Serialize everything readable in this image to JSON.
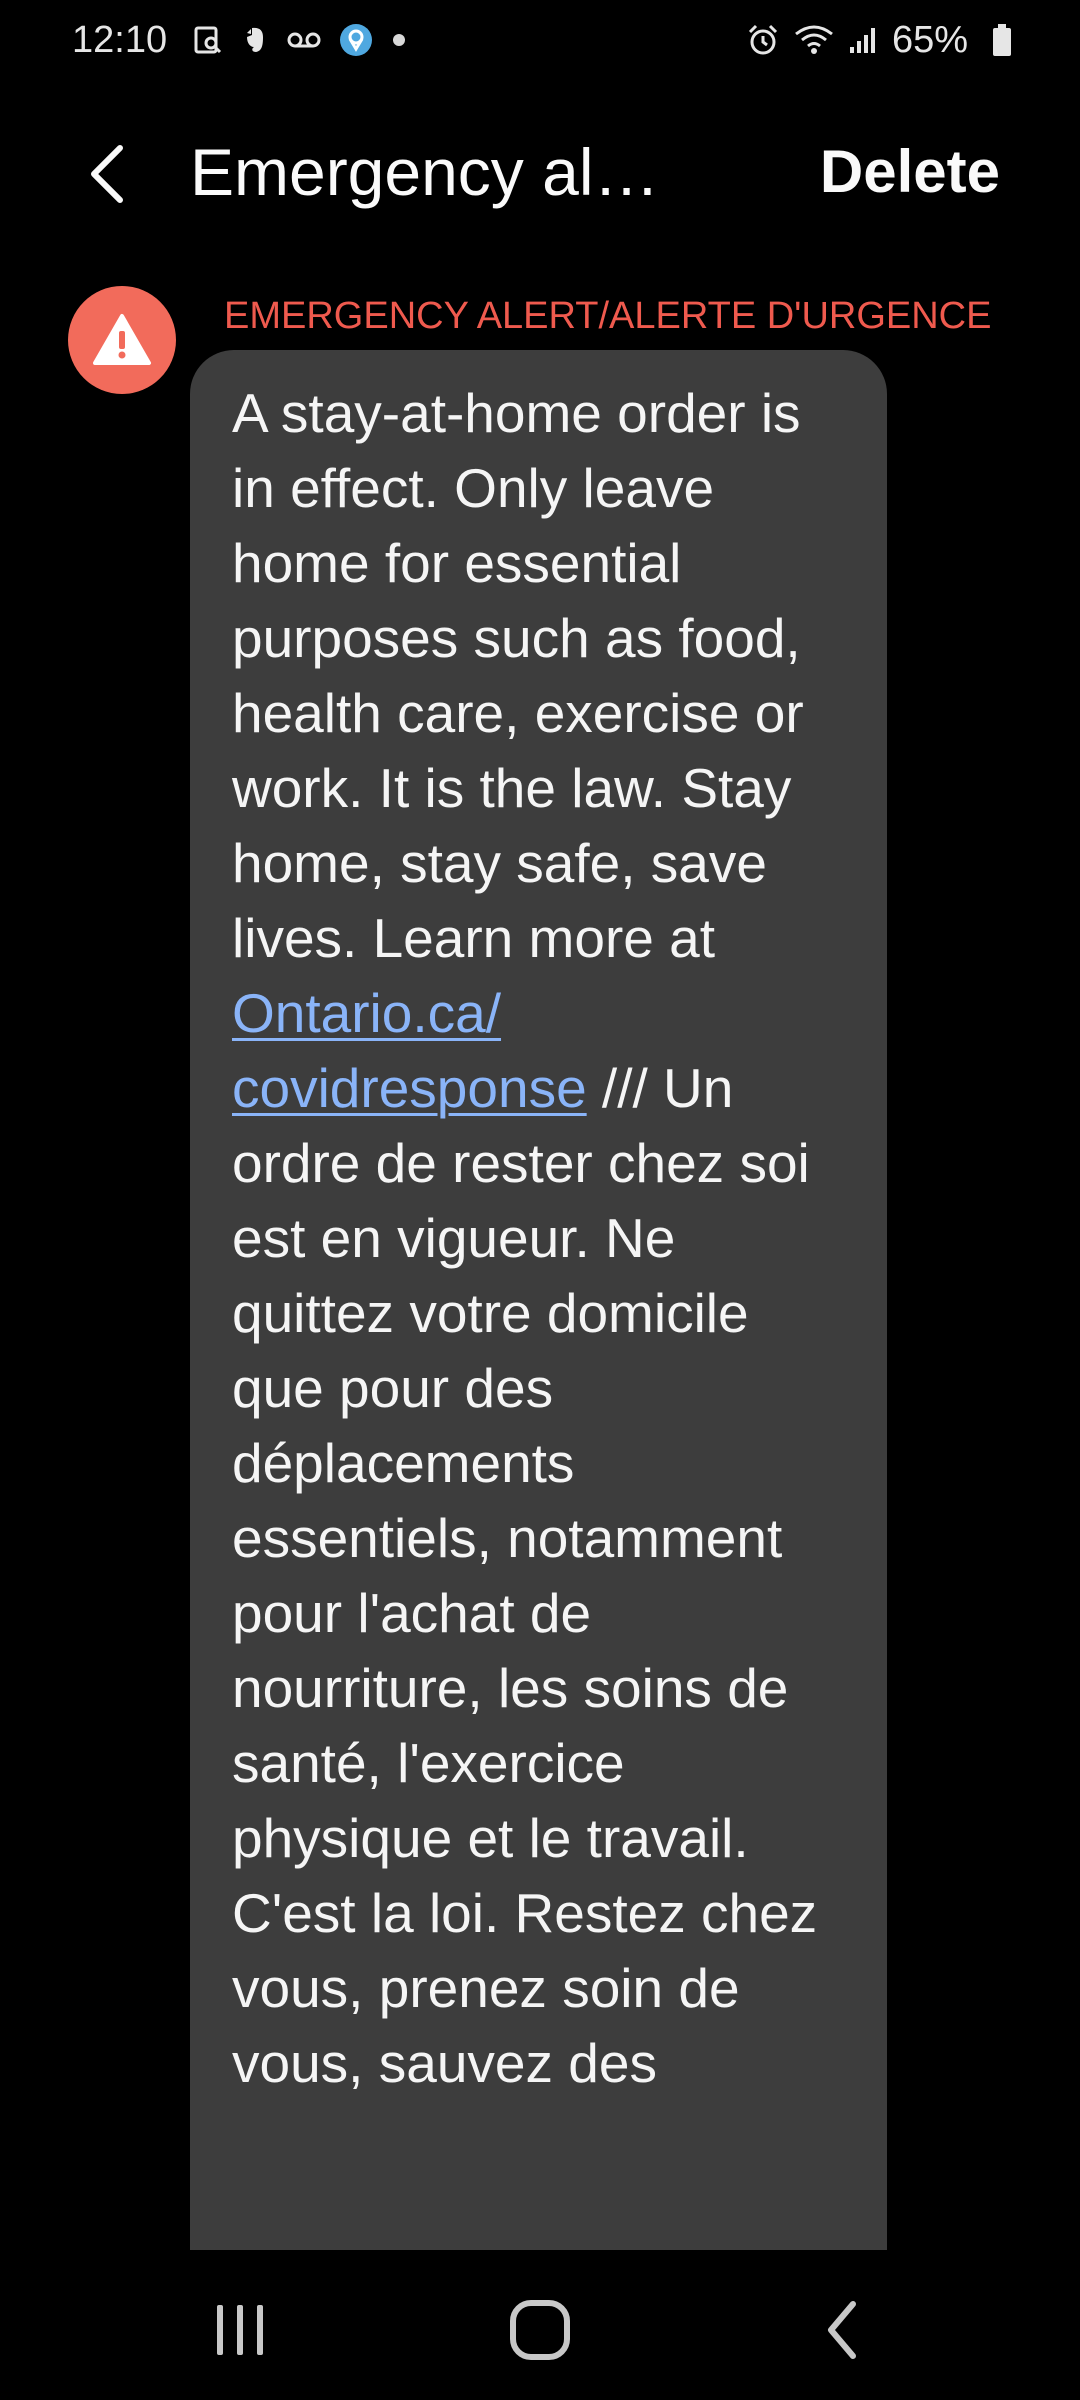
{
  "status_bar": {
    "time": "12:10",
    "battery_percent": "65%",
    "left_icons": [
      "screenshot-icon",
      "evernote-icon",
      "voicemail-icon",
      "location-app-icon",
      "more-notifications-dot-icon"
    ],
    "right_icons": [
      "alarm-icon",
      "wifi-icon",
      "signal-icon",
      "battery-icon"
    ]
  },
  "app_bar": {
    "title": "Emergency alerts",
    "delete_label": "Delete"
  },
  "message": {
    "sender": "EMERGENCY ALERT/ALERTE D'URGENCE",
    "text_before_link": "A stay-at-home order is in effect. Only leave home for essential purposes such as food, health care, exercise or work. It is the law. Stay home, stay safe, save lives. Learn more at ",
    "link_text": "Ontario.ca/ covidresponse",
    "text_after_link": " /// Un ordre de rester chez soi est en vigueur. Ne quittez votre domicile que pour des déplacements essentiels, notamment pour l'achat de nourriture, les soins de santé, l'exercice physique et le travail. C'est la loi. Restez chez vous, prenez soin de vous, sauvez des"
  },
  "colors": {
    "background": "#000000",
    "bubble": "#3d3d3d",
    "sender_label": "#ef5a4e",
    "avatar": "#f26b5b",
    "link": "#8ab4f8"
  },
  "nav_bar": {
    "icons": [
      "recent-apps-icon",
      "home-icon",
      "back-nav-icon"
    ]
  }
}
